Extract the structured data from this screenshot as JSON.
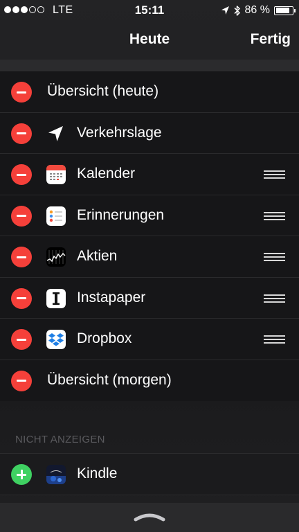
{
  "status_bar": {
    "signal_full": 3,
    "signal_total": 5,
    "carrier": "LTE",
    "time": "15:11",
    "battery_text": "86 %",
    "battery_level": 0.86
  },
  "nav": {
    "title": "Heute",
    "done_label": "Fertig"
  },
  "widgets": [
    {
      "label": "Übersicht (heute)",
      "icon": null,
      "draggable": false
    },
    {
      "label": "Verkehrslage",
      "icon": "location-arrow-icon",
      "draggable": false
    },
    {
      "label": "Kalender",
      "icon": "calendar-icon",
      "draggable": true
    },
    {
      "label": "Erinnerungen",
      "icon": "reminders-icon",
      "draggable": true
    },
    {
      "label": "Aktien",
      "icon": "stocks-icon",
      "draggable": true
    },
    {
      "label": "Instapaper",
      "icon": "instapaper-icon",
      "draggable": true
    },
    {
      "label": "Dropbox",
      "icon": "dropbox-icon",
      "draggable": true
    },
    {
      "label": "Übersicht (morgen)",
      "icon": null,
      "draggable": false
    }
  ],
  "hidden_section": {
    "title": "NICHT ANZEIGEN",
    "items": [
      {
        "label": "Kindle",
        "icon": "kindle-icon"
      }
    ]
  },
  "colors": {
    "remove": "#f5403a",
    "add": "#3fd162",
    "dropbox_blue": "#1f7fe5"
  }
}
